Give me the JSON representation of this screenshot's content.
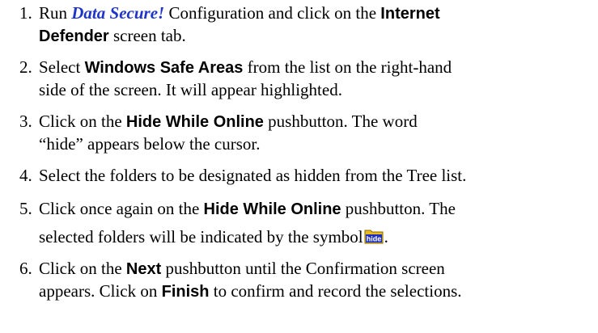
{
  "steps": [
    {
      "number": "1.",
      "line1": {
        "t1": "Run ",
        "app": "Data Secure!",
        "t2": " Configuration and click on the ",
        "b1": "Internet"
      },
      "line2": {
        "b1": "Defender",
        "t1": " screen tab."
      }
    },
    {
      "number": "2.",
      "line1": {
        "t1": "Select ",
        "b1": "Windows Safe Areas",
        "t2": " from the list on the right-hand"
      },
      "line2": {
        "t1": "side of the screen.  It will appear highlighted."
      }
    },
    {
      "number": "3.",
      "line1": {
        "t1": "Click on the ",
        "b1": "Hide While Online",
        "t2": " pushbutton.  The word"
      },
      "line2": {
        "t1": "“hide” appears below the cursor."
      }
    },
    {
      "number": "4.",
      "line1": {
        "t1": "Select the folders to be designated as hidden from the Tree list."
      }
    },
    {
      "number": "5.",
      "line1": {
        "t1": "Click once again on the ",
        "b1": "Hide While Online",
        "t2": " pushbutton.  The"
      },
      "line2": {
        "t1": "selected folders will be indicated by the symbol",
        "icon_label": "hide",
        "icon_name": "hide-folder-icon",
        "t2": "."
      }
    },
    {
      "number": "6.",
      "line1": {
        "t1": "Click on the ",
        "b1": "Next",
        "t2": " pushbutton until the Confirmation screen"
      },
      "line2": {
        "t1": "appears.  Click on ",
        "b1": "Finish",
        "t2": " to confirm and record the selections."
      }
    }
  ],
  "colors": {
    "app_name": "#1f35c9",
    "icon_folder": "#e8b923",
    "icon_label_bg": "#1e2fb8",
    "icon_label_text": "#ffffff"
  }
}
